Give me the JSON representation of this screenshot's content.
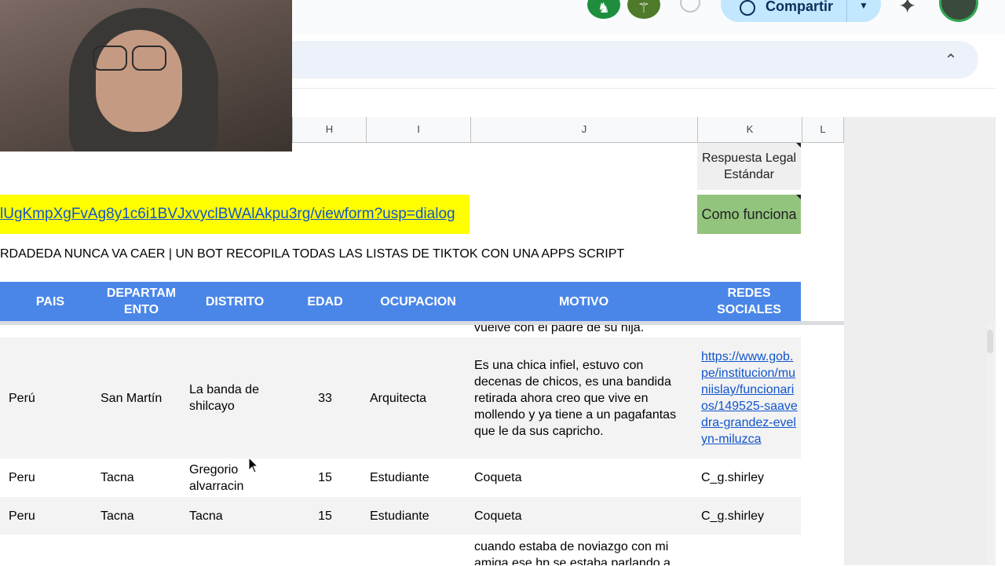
{
  "toolbar": {
    "share_label": "Compartir"
  },
  "columns": [
    {
      "label": "H"
    },
    {
      "label": "I"
    },
    {
      "label": "J"
    },
    {
      "label": "K"
    },
    {
      "label": "L"
    }
  ],
  "cells": {
    "legal_label": "Respuesta Legal Estándar",
    "como_label": "Como funciona",
    "form_link": "lUgKmpXgFvAg8y1c6i1BVJxvyclBWAlAkpu3rg/viewform?usp=dialog",
    "banner": "RDADEDA NUNCA VA CAER | UN BOT RECOPILA TODAS LAS LISTAS DE TIKTOK CON UNA APPS SCRIPT"
  },
  "table": {
    "headers": [
      "PAIS",
      "DEPARTAMENTO",
      "DISTRITO",
      "EDAD",
      "OCUPACION",
      "MOTIVO",
      "REDES SOCIALES"
    ],
    "header_display": [
      "PAIS",
      "DEPARTAM ENTO",
      "DISTRITO",
      "EDAD",
      "OCUPACION",
      "MOTIVO",
      "REDES SOCIALES"
    ],
    "partial_top_motivo": "vuelve con el padre de su hija.",
    "rows": [
      {
        "pais": "Perú",
        "departamento": "San Martín",
        "distrito": "La banda de shilcayo",
        "edad": "33",
        "ocupacion": "Arquitecta",
        "motivo": "Es una chica infiel, estuvo con decenas de chicos, es una bandida retirada ahora creo que vive en mollendo y ya tiene a un pagafantas que le da sus capricho.",
        "redes": "https://www.gob.pe/institucion/muniislay/funcionarios/149525-saavedra-grandez-evelyn-miluzca"
      },
      {
        "pais": "Peru",
        "departamento": "Tacna",
        "distrito": "Gregorio alvarracin",
        "edad": "15",
        "ocupacion": "Estudiante",
        "motivo": "Coqueta",
        "redes": "C_g.shirley"
      },
      {
        "pais": "Peru",
        "departamento": "Tacna",
        "distrito": "Tacna",
        "edad": "15",
        "ocupacion": "Estudiante",
        "motivo": "Coqueta",
        "redes": "C_g.shirley"
      },
      {
        "motivo": "cuando estaba de noviazgo con mi amiga ese hp se estaba parlando a"
      }
    ]
  },
  "icons": {
    "ext1": "extension-icon",
    "ext2": "extension-icon",
    "history": "history-icon",
    "globe": "globe-icon",
    "gemini": "gemini-sparkle-icon",
    "collapse": "chevron-up-icon"
  },
  "colors": {
    "header_blue": "#4a86e8",
    "highlight_yellow": "#ffff00",
    "como_green": "#93c47d",
    "link_blue": "#1155cc",
    "share_bg": "#c2e7ff"
  }
}
